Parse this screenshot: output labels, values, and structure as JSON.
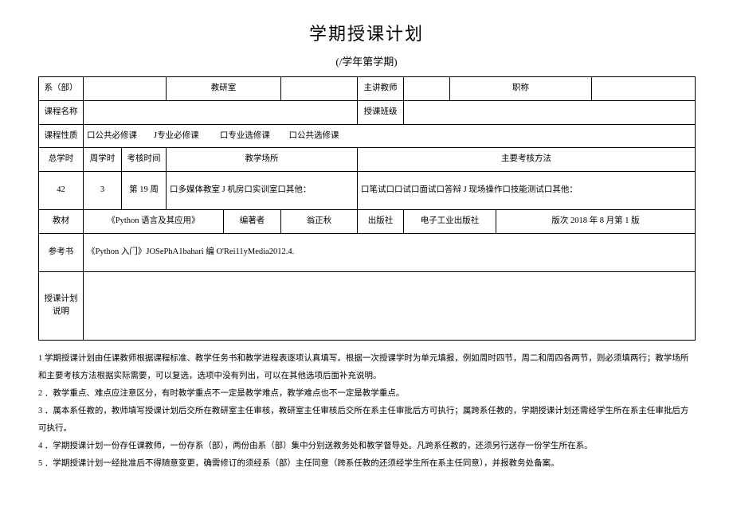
{
  "title": "学期授课计划",
  "subtitle": "(/学年第学期)",
  "labels": {
    "dept": "系（部）",
    "office": "教研室",
    "lecturer": "主讲教师",
    "rank": "职称",
    "course_name": "课程名称",
    "class": "授课班级",
    "course_type": "课程性质",
    "ct_opt1": "口公共必修课",
    "ct_opt2": "J专业必修课",
    "ct_opt3": "口专业选修课",
    "ct_opt4": "口公共选修课",
    "total_hours": "总学时",
    "weekly_hours": "周学时",
    "exam_time": "考核时间",
    "place": "教学场所",
    "exam_method": "主要考核方法",
    "total_hours_v": "42",
    "weekly_hours_v": "3",
    "exam_time_v": "第 19 周",
    "place_v": "口多媒体教室 J 机房口实训室口其他：",
    "exam_method_v": "口笔试口口试口面试口答辩 J 现场操作口技能测试口其他：",
    "textbook": "教材",
    "tb_title": "《Python 语言及其应用》",
    "tb_author_label": "编著者",
    "tb_author": "翁正秋",
    "tb_pub_label": "出版社",
    "tb_pub": "电子工业出版社",
    "tb_edition": "版次 2018 年 8 月第 1 版",
    "reference": "参考书",
    "reference_v": "《Python 入门》JOSePhA1bahari 编 O'Rei11yMedia2012.4.",
    "plan_note": "授课计划说明"
  },
  "notes": {
    "n1": "1 学期授课计划由任课教师根据课程标准、教学任务书和教学进程表逐项认真填写。根据一次授课学时为单元填报，例如周时四节，周二和周四各两节，则必须填两行；教学场所和主要考核方法根据实际需要，可以复选，选项中没有列出，可以在其他选项后面补充说明。",
    "n2": "2 ．教学重点、难点应注意区分，有时教学重点不一定是教学难点，教学难点也不一定是教学重点。",
    "n3": "3 ．属本系任教的，教师填写授课计划后交所在教研室主任审核，教研室主任审核后交所在系主任审批后方可执行；属跨系任教的，学期授课计划还需经学生所在系主任审批后方可执行。",
    "n4": "4 ．学期授课计划一份存任课教师，一份存系（部），两份由系（部）集中分别送教务处和教学督导处。凡跨系任教的，还须另行送存一份学生所在系。",
    "n5": "5 ．学期授课计划一经批准后不得随意变更，确需修订的须经系（部）主任同意（跨系任教的还须经学生所在系主任同意），并报教务处备案。"
  }
}
